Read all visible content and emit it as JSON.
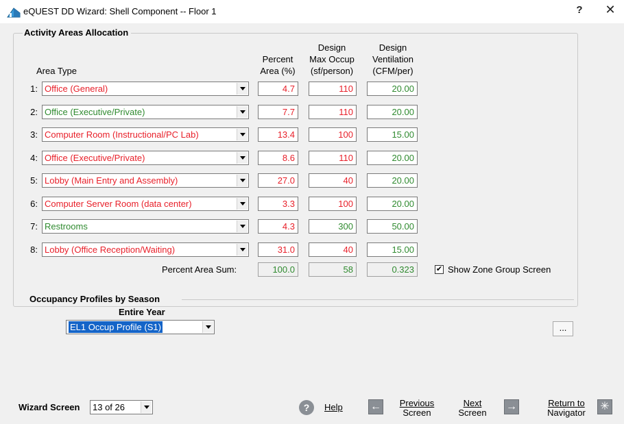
{
  "window": {
    "title": "eQUEST DD Wizard:  Shell Component  --  Floor 1",
    "help_glyph": "?",
    "close_glyph": "✕"
  },
  "activity": {
    "group_label": "Activity Areas Allocation",
    "headers": {
      "area_type": "Area Type",
      "percent": [
        "Percent",
        "Area (%)"
      ],
      "occup": [
        "Design",
        "Max Occup",
        "(sf/person)"
      ],
      "vent": [
        "Design",
        "Ventilation",
        "(CFM/per)"
      ]
    },
    "rows": [
      {
        "num": "1:",
        "type": "Office (General)",
        "type_color": "red",
        "percent": "4.7",
        "percent_color": "red",
        "occup": "110",
        "occup_color": "red",
        "vent": "20.00",
        "vent_color": "green"
      },
      {
        "num": "2:",
        "type": "Office (Executive/Private)",
        "type_color": "green",
        "percent": "7.7",
        "percent_color": "red",
        "occup": "110",
        "occup_color": "red",
        "vent": "20.00",
        "vent_color": "green"
      },
      {
        "num": "3:",
        "type": "Computer Room (Instructional/PC Lab)",
        "type_color": "red",
        "percent": "13.4",
        "percent_color": "red",
        "occup": "100",
        "occup_color": "red",
        "vent": "15.00",
        "vent_color": "green"
      },
      {
        "num": "4:",
        "type": "Office (Executive/Private)",
        "type_color": "red",
        "percent": "8.6",
        "percent_color": "red",
        "occup": "110",
        "occup_color": "red",
        "vent": "20.00",
        "vent_color": "green"
      },
      {
        "num": "5:",
        "type": "Lobby (Main Entry and Assembly)",
        "type_color": "red",
        "percent": "27.0",
        "percent_color": "red",
        "occup": "40",
        "occup_color": "red",
        "vent": "20.00",
        "vent_color": "green"
      },
      {
        "num": "6:",
        "type": "Computer Server Room (data center)",
        "type_color": "red",
        "percent": "3.3",
        "percent_color": "red",
        "occup": "100",
        "occup_color": "red",
        "vent": "20.00",
        "vent_color": "green"
      },
      {
        "num": "7:",
        "type": "Restrooms",
        "type_color": "green",
        "percent": "4.3",
        "percent_color": "red",
        "occup": "300",
        "occup_color": "green",
        "vent": "50.00",
        "vent_color": "green"
      },
      {
        "num": "8:",
        "type": "Lobby (Office Reception/Waiting)",
        "type_color": "red",
        "percent": "31.0",
        "percent_color": "red",
        "occup": "40",
        "occup_color": "red",
        "vent": "15.00",
        "vent_color": "green"
      }
    ],
    "sum_label": "Percent Area Sum:",
    "sum_percent": "100.0",
    "sum_occup": "58",
    "sum_vent": "0.323",
    "show_zone_label": "Show Zone Group Screen",
    "show_zone_checked": "✔"
  },
  "occupancy": {
    "group_label": "Occupancy Profiles by Season",
    "season_label": "Entire Year",
    "profile_value": "EL1 Occup Profile (S1)",
    "ellipsis": "..."
  },
  "bottom": {
    "wizard_screen_label": "Wizard Screen",
    "wizard_screen_value": "13 of 26",
    "help_icon": "?",
    "help_label": "Help",
    "previous_line1": "Previous",
    "previous_line2": "Screen",
    "next_line1": "Next",
    "next_line2": "Screen",
    "return_line1": "Return to",
    "return_line2": "Navigator"
  },
  "colors": {
    "red": "#e8202a",
    "green": "#2f8a2f",
    "selection": "#1464c8"
  }
}
